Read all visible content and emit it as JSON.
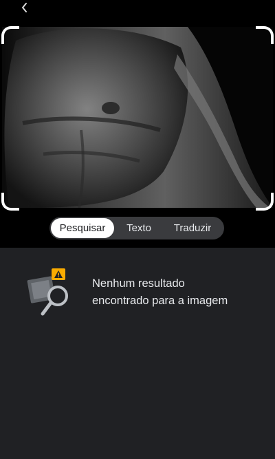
{
  "header": {
    "back_icon": "chevron-left-icon"
  },
  "preview": {
    "description_icon": "photo-preview",
    "corner_color": "#ffffff"
  },
  "tabs": [
    {
      "label": "Pesquisar",
      "active": true
    },
    {
      "label": "Texto",
      "active": false
    },
    {
      "label": "Traduzir",
      "active": false
    }
  ],
  "results": {
    "icon": "image-search-warning-icon",
    "line1": "Nenhum resultado",
    "line2": "encontrado para a imagem"
  },
  "colors": {
    "panel_bg": "#202124",
    "tab_bg": "#3a3b3e",
    "warning": "#f9ab00"
  }
}
